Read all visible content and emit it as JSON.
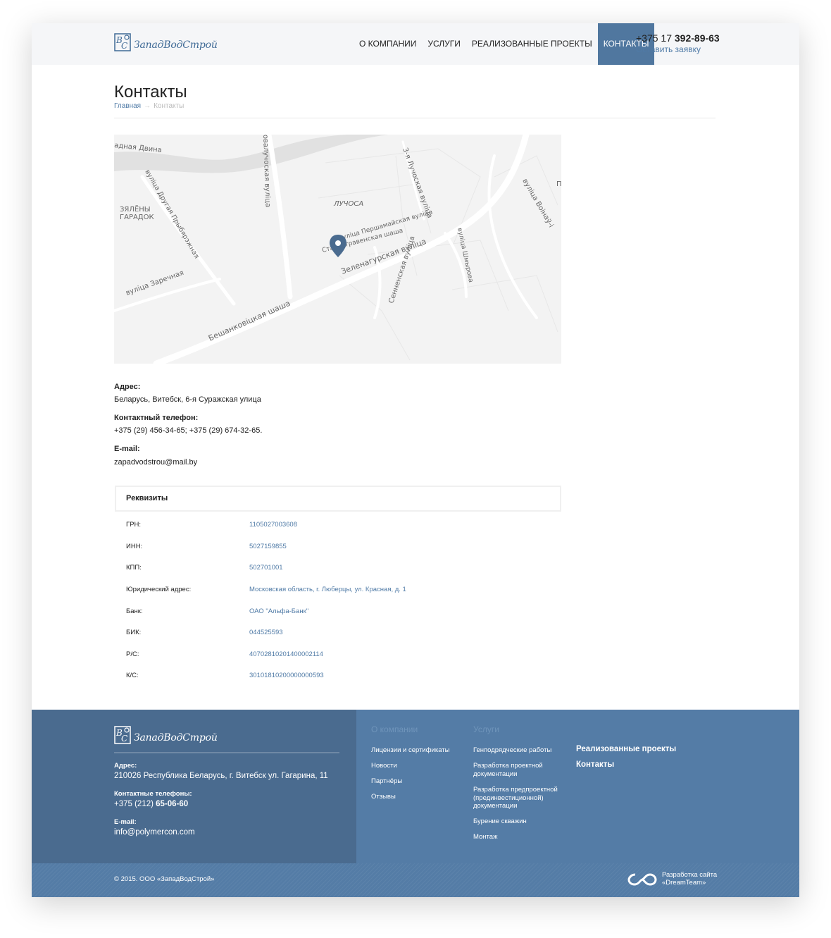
{
  "header": {
    "logo_text": "ЗападВодСтрой",
    "nav": [
      "О компании",
      "Услуги",
      "Реализованные проекты",
      "Контакты"
    ],
    "phone_prefix": "+375 17 ",
    "phone_main": "392-89-63",
    "request_link": "Оставить заявку",
    "accent_color": "#50779f"
  },
  "page": {
    "title": "Контакты",
    "breadcrumb_home": "Главная",
    "breadcrumb_sep": "→",
    "breadcrumb_current": "Контакты"
  },
  "map": {
    "labels": [
      "адная Двина",
      "овалучоская вуліца",
      "3-я Лучоская вуліца",
      "ЛУЧОСА",
      "ЗЯЛЁНЫ",
      "ГАРАДОК",
      "вуліца Другая Прыбярэжная",
      "вуліца Першамайская вуліца",
      "Старастравенская шаша",
      "Зеленагурская вуліца",
      "вуліца Шмырова",
      "Сенненская вуліца",
      "вуліца Заречная",
      "Бешанковіцкая шаша",
      "вуліца Вoінаў-і",
      "П"
    ]
  },
  "contacts": {
    "address_label": "Адрес:",
    "address": "Беларусь, Витебск, 6-я Суражская улица",
    "phone_label": "Контактный телефон:",
    "phone": "+375 (29) 456-34-65;  +375 (29) 674-32-65.",
    "email_label": "E-mail:",
    "email": "zapadvodstrou@mail.by"
  },
  "requisites": {
    "title": "Реквизиты",
    "rows": [
      {
        "key": "ГРН:",
        "value": "1105027003608"
      },
      {
        "key": "ИНН:",
        "value": "5027159855"
      },
      {
        "key": "КПП:",
        "value": "502701001"
      },
      {
        "key": "Юридический адрес:",
        "value": "Московская область, г. Люберцы, ул. Красная, д. 1"
      },
      {
        "key": "Банк:",
        "value": "ОАО \"Альфа-Банк\""
      },
      {
        "key": "БИК:",
        "value": "044525593"
      },
      {
        "key": "Р/С:",
        "value": "40702810201400002114"
      },
      {
        "key": "К/С:",
        "value": "30101810200000000593"
      }
    ]
  },
  "footer": {
    "logo_text": "ЗападВодСтрой",
    "address_label": "Адрес:",
    "address": "210026 Республика Беларусь, г. Витебск ул. Гагарина, 11",
    "phones_label": "Контактные телефоны:",
    "phone_prefix": "+375 (212) ",
    "phone_main": "65-06-60",
    "email_label": "E-mail:",
    "email": "info@polymercon.com",
    "col_company_title": "О компании",
    "col_company_links": [
      "Лицензии и сертификаты",
      "Новости",
      "Партнёры",
      "Отзывы"
    ],
    "col_services_title": "Услуги",
    "col_services_links": [
      "Генподрядческие работы",
      "Разработка проектной документации",
      "Разработка предпроектной (прединвестиционной) документации",
      "Бурение скважин",
      "Монтаж"
    ],
    "big_links": [
      "Реализованные проекты",
      "Контакты"
    ],
    "copyright": "© 2015. ООО «ЗападВодСтрой»",
    "dev_line1": "Разработка сайта",
    "dev_line2": "«DreamTeam»"
  }
}
